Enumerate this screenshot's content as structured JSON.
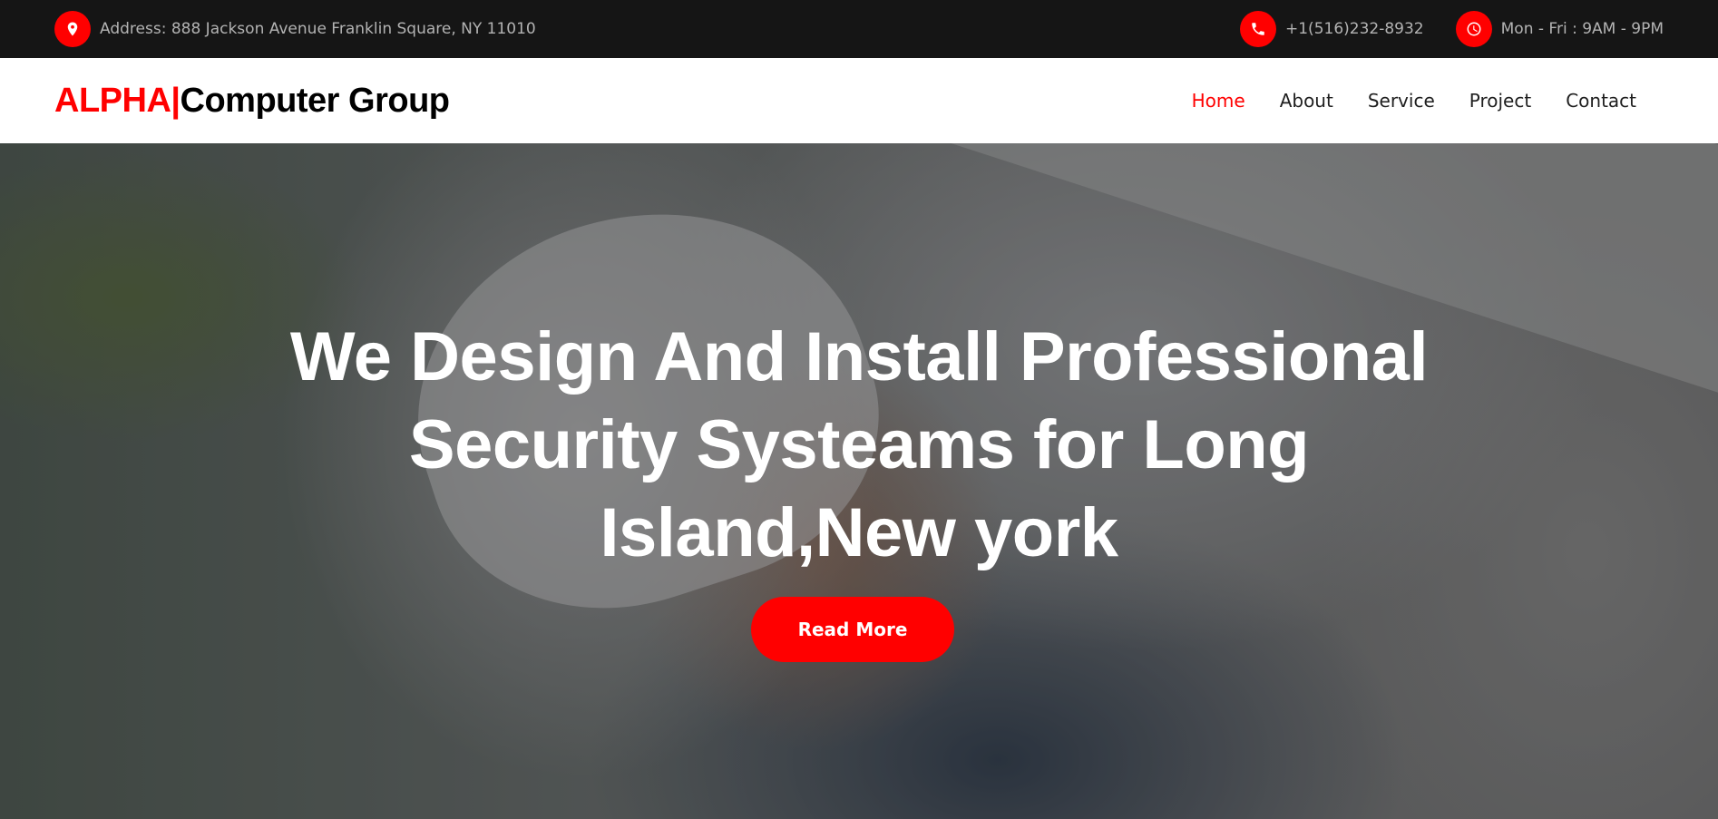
{
  "topbar": {
    "address": {
      "icon": "map-pin-icon",
      "text": "Address: 888 Jackson Avenue Franklin Square, NY 11010"
    },
    "phone": {
      "icon": "phone-icon",
      "text": "+1(516)232-8932"
    },
    "hours": {
      "icon": "clock-icon",
      "text": "Mon - Fri : 9AM - 9PM"
    }
  },
  "brand": {
    "part1": "ALPHA|",
    "part2": "Computer Group"
  },
  "nav": {
    "items": [
      {
        "label": "Home",
        "active": true
      },
      {
        "label": "About",
        "active": false
      },
      {
        "label": "Service",
        "active": false
      },
      {
        "label": "Project",
        "active": false
      },
      {
        "label": "Contact",
        "active": false
      }
    ]
  },
  "hero": {
    "title": "We Design And Install Professional Security Systeams for Long Island,New york",
    "button_label": "Read More"
  },
  "colors": {
    "accent": "#ff0000",
    "topbar_bg": "#151515",
    "nav_text": "#1f1f1f"
  }
}
